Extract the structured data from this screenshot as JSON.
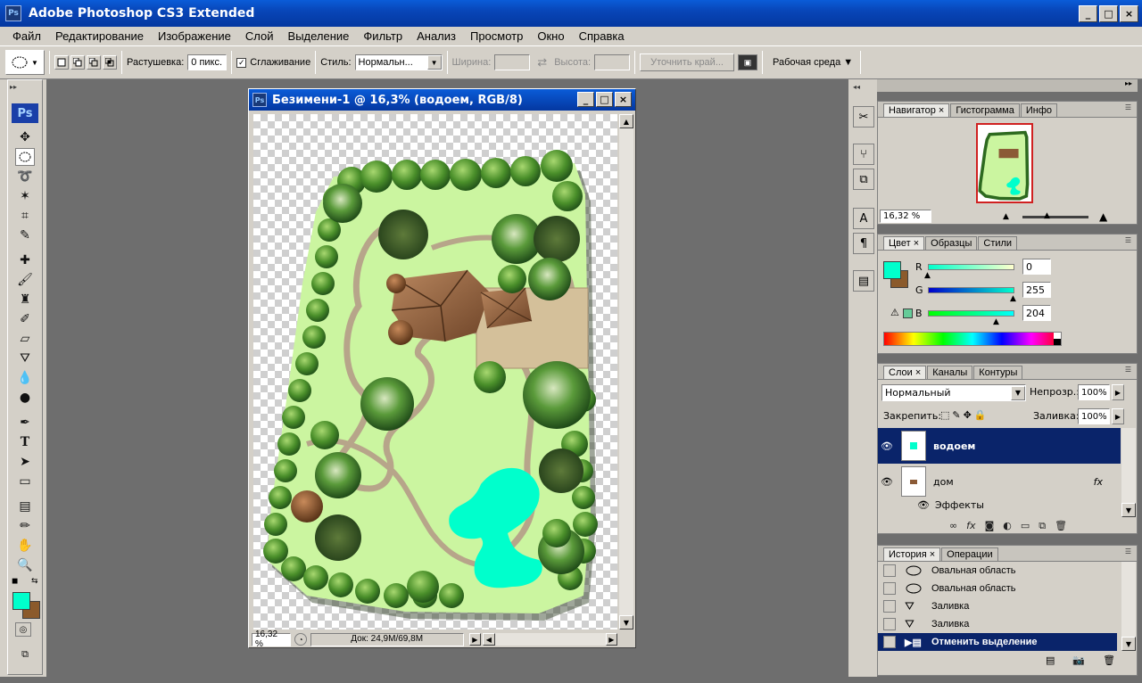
{
  "app": {
    "title": "Adobe Photoshop CS3 Extended",
    "icon": "Ps"
  },
  "window_buttons": {
    "min": "_",
    "max": "□",
    "close": "×"
  },
  "menu": [
    "Файл",
    "Редактирование",
    "Изображение",
    "Слой",
    "Выделение",
    "Фильтр",
    "Анализ",
    "Просмотр",
    "Окно",
    "Справка"
  ],
  "options": {
    "feather_label": "Растушевка:",
    "feather_value": "0 пикс.",
    "antialias_label": "Сглаживание",
    "style_label": "Стиль:",
    "style_value": "Нормальн...",
    "width_label": "Ширина:",
    "height_label": "Высота:",
    "refine_button": "Уточнить край...",
    "workspace_label": "Рабочая среда ▼"
  },
  "document": {
    "title": "Безимени-1 @ 16,3% (водоем, RGB/8)",
    "zoom": "16,32 %",
    "doc_size": "Док: 24,9M/69,8M"
  },
  "navigator": {
    "tabs": [
      "Навигатор",
      "Гистограмма",
      "Инфо"
    ],
    "zoom": "16,32 %"
  },
  "color_panel": {
    "tabs": [
      "Цвет",
      "Образцы",
      "Стили"
    ],
    "channels": [
      {
        "label": "R",
        "value": "0",
        "fraction": 0.0
      },
      {
        "label": "G",
        "value": "255",
        "fraction": 1.0
      },
      {
        "label": "B",
        "value": "204",
        "fraction": 0.8
      }
    ],
    "fg_color": "#00ffcc",
    "bg_color": "#8b5a2b"
  },
  "layers": {
    "tabs": [
      "Слои",
      "Каналы",
      "Контуры"
    ],
    "blend_mode": "Нормальный",
    "opacity_label": "Непрозр.:",
    "opacity_value": "100%",
    "lock_label": "Закрепить:",
    "fill_label": "Заливка:",
    "fill_value": "100%",
    "items": [
      {
        "name": "водоем",
        "selected": true
      },
      {
        "name": "дом",
        "selected": false,
        "fx": "fx"
      }
    ],
    "effects_label": "Эффекты"
  },
  "history": {
    "tabs": [
      "История",
      "Операции"
    ],
    "items": [
      "Овальная область",
      "Овальная область",
      "Заливка",
      "Заливка",
      "Отменить выделение"
    ]
  }
}
